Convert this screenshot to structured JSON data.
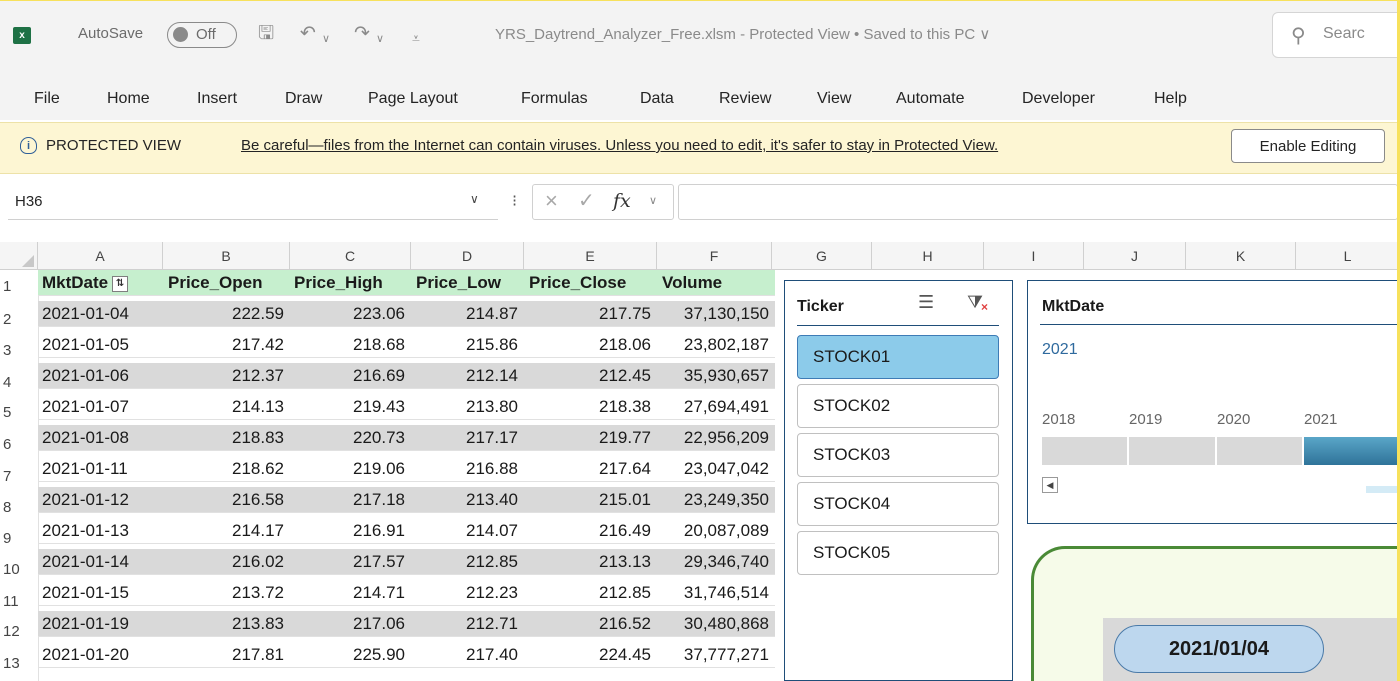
{
  "titlebar": {
    "autosave_label": "AutoSave",
    "autosave_state": "Off",
    "file_title": "YRS_Daytrend_Analyzer_Free.xlsm  -  Protected View  •  Saved to this PC ∨",
    "search_placeholder": "Searc",
    "icons": [
      "excel-icon",
      "save-icon",
      "undo-icon",
      "redo-icon",
      "customize-quick-access-icon",
      "search-icon"
    ]
  },
  "menu": [
    "File",
    "Home",
    "Insert",
    "Draw",
    "Page Layout",
    "Formulas",
    "Data",
    "Review",
    "View",
    "Automate",
    "Developer",
    "Help"
  ],
  "protected_view": {
    "title": "PROTECTED VIEW",
    "message": "Be careful—files from the Internet can contain viruses. Unless you need to edit, it's safer to stay in Protected View.",
    "button": "Enable Editing"
  },
  "formula_bar": {
    "name_box": "H36",
    "fx": "fx",
    "formula": ""
  },
  "columns": [
    "A",
    "B",
    "C",
    "D",
    "E",
    "F",
    "G",
    "H",
    "I",
    "J",
    "K",
    "L"
  ],
  "rows": [
    "1",
    "2",
    "3",
    "4",
    "5",
    "6",
    "7",
    "8",
    "9",
    "10",
    "11",
    "12",
    "13"
  ],
  "table": {
    "headers": [
      "MktDate",
      "Price_Open",
      "Price_High",
      "Price_Low",
      "Price_Close",
      "Volume"
    ],
    "data": [
      [
        "2021-01-04",
        "222.59",
        "223.06",
        "214.87",
        "217.75",
        "37,130,150"
      ],
      [
        "2021-01-05",
        "217.42",
        "218.68",
        "215.86",
        "218.06",
        "23,802,187"
      ],
      [
        "2021-01-06",
        "212.37",
        "216.69",
        "212.14",
        "212.45",
        "35,930,657"
      ],
      [
        "2021-01-07",
        "214.13",
        "219.43",
        "213.80",
        "218.38",
        "27,694,491"
      ],
      [
        "2021-01-08",
        "218.83",
        "220.73",
        "217.17",
        "219.77",
        "22,956,209"
      ],
      [
        "2021-01-11",
        "218.62",
        "219.06",
        "216.88",
        "217.64",
        "23,047,042"
      ],
      [
        "2021-01-12",
        "216.58",
        "217.18",
        "213.40",
        "215.01",
        "23,249,350"
      ],
      [
        "2021-01-13",
        "214.17",
        "216.91",
        "214.07",
        "216.49",
        "20,087,089"
      ],
      [
        "2021-01-14",
        "216.02",
        "217.57",
        "212.85",
        "213.13",
        "29,346,740"
      ],
      [
        "2021-01-15",
        "213.72",
        "214.71",
        "212.23",
        "212.85",
        "31,746,514"
      ],
      [
        "2021-01-19",
        "213.83",
        "217.06",
        "212.71",
        "216.52",
        "30,480,868"
      ],
      [
        "2021-01-20",
        "217.81",
        "225.90",
        "217.40",
        "224.45",
        "37,777,271"
      ]
    ]
  },
  "ticker_slicer": {
    "title": "Ticker",
    "items": [
      "STOCK01",
      "STOCK02",
      "STOCK03",
      "STOCK04",
      "STOCK05"
    ],
    "selected": "STOCK01",
    "icons": [
      "multi-select-icon",
      "clear-filter-icon"
    ]
  },
  "timeline": {
    "title": "MktDate",
    "selection": "2021",
    "years": [
      "2018",
      "2019",
      "2020",
      "2021"
    ],
    "selected_year": "2021",
    "bar_color": "#d9d9d9",
    "selected_color": "#3a89ad"
  },
  "dashboard": {
    "date": "2021/01/04",
    "border_color": "#4a8a36"
  }
}
